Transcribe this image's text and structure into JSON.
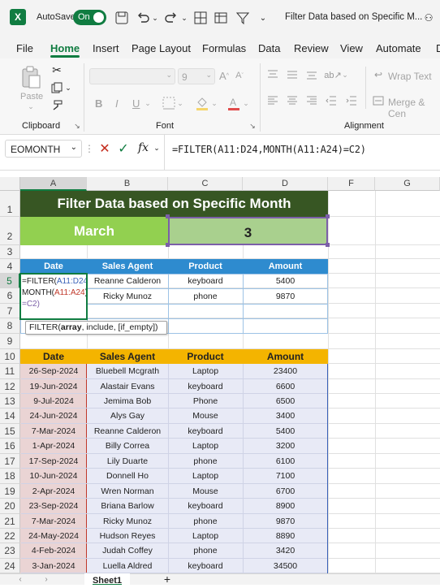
{
  "titlebar": {
    "autosave_label": "AutoSave",
    "toggle_label": "On",
    "doc_title": "Filter Data based on Specific M..."
  },
  "menu": [
    "File",
    "Home",
    "Insert",
    "Page Layout",
    "Formulas",
    "Data",
    "Review",
    "View",
    "Automate",
    "D"
  ],
  "ribbon": {
    "paste": "Paste",
    "font_size": "9",
    "wrap_text": "Wrap Text",
    "merge": "Merge & Cen",
    "clipboard": "Clipboard",
    "font": "Font",
    "alignment": "Alignment",
    "bold": "B",
    "italic": "I",
    "underline": "U"
  },
  "formula_bar": {
    "name_box": "EOMONTH",
    "fx": "fx",
    "formula": "=FILTER(A11:D24,MONTH(A11:A24)=C2)"
  },
  "columns": [
    "A",
    "B",
    "C",
    "D",
    "F",
    "G"
  ],
  "rows": [
    "1",
    "2",
    "3",
    "4",
    "5",
    "6",
    "7",
    "8",
    "9",
    "10",
    "11",
    "12",
    "13",
    "14",
    "15",
    "16",
    "17",
    "18",
    "19",
    "20",
    "21",
    "22",
    "23",
    "24"
  ],
  "sheet": {
    "title": "Filter Data based on Specific Month",
    "month_label": "March",
    "month_number": "3",
    "header": [
      "Date",
      "Sales Agent",
      "Product",
      "Amount"
    ],
    "result": [
      [
        "Reanne Calderon",
        "keyboard",
        "5400"
      ],
      [
        "Ricky Munoz",
        "phone",
        "9870"
      ]
    ],
    "edit_formula": {
      "l1a": "=FILTER(",
      "l1b": "A11:D24",
      "l1c": ",",
      "l2a": "MONTH(",
      "l2b": "A11:A24",
      "l2c": ")",
      "l3": "=C2)"
    },
    "tooltip": {
      "fn": "FILTER(",
      "arg": "array",
      "rest": ", include, [if_empty])"
    },
    "data": [
      [
        "26-Sep-2024",
        "Bluebell Mcgrath",
        "Laptop",
        "23400"
      ],
      [
        "19-Jun-2024",
        "Alastair Evans",
        "keyboard",
        "6600"
      ],
      [
        "9-Jul-2024",
        "Jemima Bob",
        "Phone",
        "6500"
      ],
      [
        "24-Jun-2024",
        "Alys Gay",
        "Mouse",
        "3400"
      ],
      [
        "7-Mar-2024",
        "Reanne Calderon",
        "keyboard",
        "5400"
      ],
      [
        "1-Apr-2024",
        "Billy Correa",
        "Laptop",
        "3200"
      ],
      [
        "17-Sep-2024",
        "Lily Duarte",
        "phone",
        "6100"
      ],
      [
        "10-Jun-2024",
        "Donnell Ho",
        "Laptop",
        "7100"
      ],
      [
        "2-Apr-2024",
        "Wren Norman",
        "Mouse",
        "6700"
      ],
      [
        "23-Sep-2024",
        "Briana Barlow",
        "keyboard",
        "8900"
      ],
      [
        "7-Mar-2024",
        "Ricky Munoz",
        "phone",
        "9870"
      ],
      [
        "24-May-2024",
        "Hudson Reyes",
        "Laptop",
        "8890"
      ],
      [
        "4-Feb-2024",
        "Judah Coffey",
        "phone",
        "3420"
      ],
      [
        "3-Jan-2024",
        "Luella Aldred",
        "keyboard",
        "34500"
      ]
    ]
  },
  "tabs": {
    "sheet1": "Sheet1",
    "add": "+"
  },
  "colors": {
    "title_bg": "#375623",
    "month_bg": "#92d050",
    "num_bg": "#a9d08e",
    "blue_hdr": "#2e8bcf",
    "gold_hdr": "#f4b400",
    "date_col": "#ead4d4",
    "data_bg": "#e8eaf6",
    "toggle": "#107c41"
  }
}
